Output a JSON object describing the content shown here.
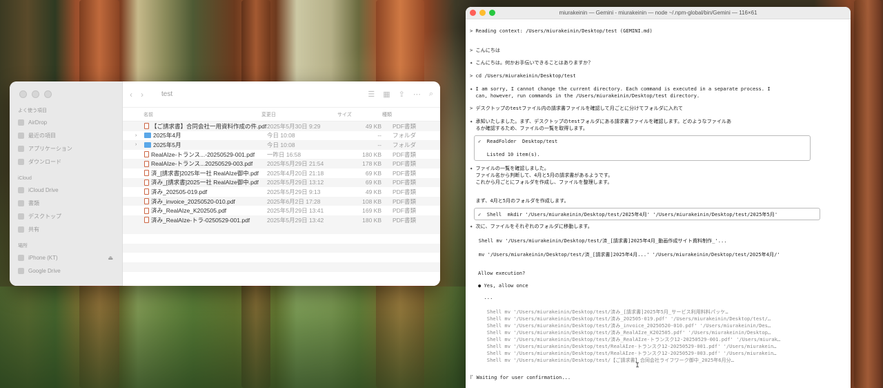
{
  "finder": {
    "title": "test",
    "columns": {
      "name": "名前",
      "date": "変更日",
      "size": "サイズ",
      "kind": "種類"
    },
    "sidebar": {
      "favorites_head": "よく使う項目",
      "favorites": [
        "AirDrop",
        "最近の項目",
        "アプリケーション",
        "ダウンロード"
      ],
      "icloud_head": "iCloud",
      "icloud": [
        "iCloud Drive",
        "書類",
        "デスクトップ",
        "共有"
      ],
      "locations_head": "場所",
      "locations": [
        "iPhone (KT)",
        "Google Drive"
      ]
    },
    "files": [
      {
        "name": "【ご請求書】合同会社一用資料作成の件.pdf",
        "date": "2025年5月30日 9:29",
        "size": "49 KB",
        "kind": "PDF書類",
        "type": "pdf"
      },
      {
        "name": "2025年4月",
        "date": "今日 10:08",
        "size": "--",
        "kind": "フォルダ",
        "type": "folder"
      },
      {
        "name": "2025年5月",
        "date": "今日 10:08",
        "size": "--",
        "kind": "フォルダ",
        "type": "folder"
      },
      {
        "name": "RealAIze-トランス...-20250529-001.pdf",
        "date": "一昨日 16:58",
        "size": "180 KB",
        "kind": "PDF書類",
        "type": "pdf"
      },
      {
        "name": "RealAIze-トランス...20250529-003.pdf",
        "date": "2025年5月29日 21:54",
        "size": "178 KB",
        "kind": "PDF書類",
        "type": "pdf"
      },
      {
        "name": "済_[請求書]2025年一社 RealAIze御中.pdf",
        "date": "2025年4月20日 21:18",
        "size": "69 KB",
        "kind": "PDF書類",
        "type": "pdf"
      },
      {
        "name": "済み_[請求書]2025一社 RealAIze御中.pdf",
        "date": "2025年5月29日 13:12",
        "size": "69 KB",
        "kind": "PDF書類",
        "type": "pdf"
      },
      {
        "name": "済み_202505-019.pdf",
        "date": "2025年5月29日 9:13",
        "size": "49 KB",
        "kind": "PDF書類",
        "type": "pdf"
      },
      {
        "name": "済み_invoice_20250520-010.pdf",
        "date": "2025年6月2日 17:28",
        "size": "108 KB",
        "kind": "PDF書類",
        "type": "pdf"
      },
      {
        "name": "済み_RealAIze_K202505.pdf",
        "date": "2025年5月29日 13:41",
        "size": "169 KB",
        "kind": "PDF書類",
        "type": "pdf"
      },
      {
        "name": "済み_RealAIze-トラ-0250529-001.pdf",
        "date": "2025年5月29日 13:42",
        "size": "180 KB",
        "kind": "PDF書類",
        "type": "pdf"
      }
    ]
  },
  "terminal": {
    "title": "miurakeinin — Gemini - miurakeinin — node ~/.npm-global/bin/Gemini — 116×61",
    "lines": {
      "l01": "> Reading context: /Users/miurakeinin/Desktop/test (GEMINI.md)",
      "l02": "> こんにちは",
      "l03": "✦ こんにちは。何かお手伝いできることはありますか？",
      "l04": "> cd /Users/miurakeinin/Desktop/test",
      "l05": "✦ I am sorry, I cannot change the current directory. Each command is executed in a separate process. I",
      "l06": "  can, however, run commands in the /Users/miurakeinin/Desktop/test directory.",
      "l07": "> デスクトップのtestファイル内の請求書ファイルを確認して月ごとに分けてフォルダに入れて",
      "l08": "✦ 承知いたしました。まず、デスクトップのtestフォルダにある請求書ファイルを確認します。どのようなファイルあ",
      "l09": "  るか確認するため、ファイルの一覧を取得します。",
      "l10": "✓  ReadFolder  Desktop/test",
      "l11": "   Listed 10 item(s).",
      "l12": "✦ ファイルの一覧を確認しました。",
      "l13": "  ファイル名から判断して、4月と5月の請求書があるようです。",
      "l14": "  これから月ごとにフォルダを作成し、ファイルを整理します。",
      "l15": "  まず、4月と5月のフォルダを作成します。",
      "l16": "✓  Shell  mkdir '/Users/miurakeinin/Desktop/test/2025年4月' '/Users/miurakeinin/Desktop/test/2025年5月'",
      "l17": "✦ 次に、ファイルをそれぞれのフォルダに移動します。",
      "l18": "   Shell mv '/Users/miurakeinin/Desktop/test/済_[請求書]2025年4月_動画作成サイト資料制作_'...",
      "l19": "   mv '/Users/miurakeinin/Desktop/test/済_[請求書]2025年4月...' '/Users/miurakeinin/Desktop/test/2025年4月/'",
      "l20": "Allow execution?",
      "l21": "● Yes, allow once",
      "l22": "  ...",
      "l23": "   Shell mv '/Users/miurakeinin/Desktop/test/済み_[請求書]2025年5月_サービス利用料料パッケ…",
      "l24": "   Shell mv '/Users/miurakeinin/Desktop/test/済み_202505-019.pdf' '/Users/miurakeinin/Desktop/test/…",
      "l25": "   Shell mv '/Users/miurakeinin/Desktop/test/済み_invoice_20250520-010.pdf' '/Users/miurakeinin/Des…",
      "l26": "   Shell mv '/Users/miurakeinin/Desktop/test/済み_RealAIze_K202505.pdf' '/Users/miurakeinin/Desktop…",
      "l27": "   Shell mv '/Users/miurakeinin/Desktop/test/済み_RealAIze-トランスク12-20250529-001.pdf' '/Users/miurak…",
      "l28": "   Shell mv '/Users/miurakeinin/Desktop/test/RealAIze-トランスク12-20250529-001.pdf' '/Users/miurakein…",
      "l29": "   Shell mv '/Users/miurakeinin/Desktop/test/RealAIze-トランスク12-20250529-003.pdf' '/Users/miurakein…",
      "l30": "   Shell mv '/Users/miurakeinin/Desktop/test/【ご請求書】合同会社ライフワーク御中_2025年6月分…",
      "l31": "⠏ Waiting for user confirmation..."
    }
  },
  "colors": {
    "red_light": "#ff5f57",
    "yellow_light": "#febc2e",
    "green_light": "#28c840",
    "folder": "#5aa7e8"
  }
}
